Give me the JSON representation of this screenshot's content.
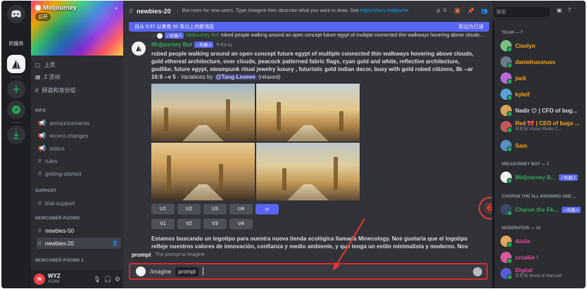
{
  "rail": {
    "label": "的服务",
    "colors": {
      "discord": "#5865f2",
      "green": "#23a55a"
    }
  },
  "server": {
    "name": "Midjourney",
    "badge": "公开",
    "nav": [
      "上页",
      "2 活动",
      "频道和身份组"
    ]
  },
  "categories": {
    "info": "INFO",
    "support": "SUPPORT",
    "newcomer": "NEWCOMER ROOMS",
    "newcomer2": "NEWCOMER ROOMS 2"
  },
  "channels": {
    "info": [
      "announcements",
      "recent-changes",
      "status",
      "rules",
      "getting-started"
    ],
    "support": [
      "trial-support"
    ],
    "newcomer": [
      "newbies-50",
      "newbies-20"
    ]
  },
  "user": {
    "name": "WYZ",
    "tag": "#5264",
    "avatar_text": "W"
  },
  "header": {
    "channel": "newbies-20",
    "topic": "Bot room for new users. Type /imagine then describe what you want to draw. See",
    "topic_link": "https://docs.midjourne",
    "member_count": "5"
  },
  "notice": {
    "text": "自从 9:37 以来有 50 条以上的新消息",
    "action": "标记为已读"
  },
  "reply": {
    "author": "Midjourney Bot",
    "tag": "✓机器人",
    "text": "robed people walking around an open concept future egypt of multiple connected thin walkways hovering above clouds..."
  },
  "message": {
    "author": "Midjourney Bot",
    "tag": "✓机器人",
    "time": "今天9:41",
    "body": "robed people walking around an open concept future egypt of multiple connected thin walkways hovering above clouds, gold ethereal architecture, over clouds, peacock patterned fabric flags, cyan gold and white, reflective architecture, godlike, future egypt, steampunk ritual jewelry luxury , futuristic gold indian decor, busy with gold robed citizens, 8k --ar 16:9 --v 5",
    "meta_prefix": " - Variations by ",
    "mention": "@Tang-Leeeee",
    "meta_suffix": " (relaxed)"
  },
  "buttons": {
    "upscale": [
      "U1",
      "U2",
      "U3",
      "U4"
    ],
    "variations": [
      "V1",
      "V2",
      "V3",
      "V4"
    ]
  },
  "message2": {
    "body": "Estamos buscando un logotipo para nuestra nueva tienda ecológica llamada Minecology. Nos gustaría que el logotipo refleje nuestros valores de innovación, confianza y medio ambiente, y que tenga un estilo minimalista y moderno. Nos"
  },
  "prompt_hint": {
    "name": "prompt",
    "desc": "The prompt to imagine"
  },
  "input": {
    "command": "/imagine",
    "option": "prompt"
  },
  "annotation": {
    "number": "⑥",
    "color": "#e53935"
  },
  "members": {
    "search_placeholder": "搜索",
    "team_label": "TEAM — 7",
    "team": [
      {
        "name": "Cixelyn",
        "sub": "",
        "color": "#faa61a"
      },
      {
        "name": "danielrussruss",
        "sub": "",
        "color": "#faa61a"
      },
      {
        "name": "jack",
        "sub": "",
        "color": "#faa61a"
      },
      {
        "name": "kyleif",
        "sub": "",
        "color": "#faa61a"
      },
      {
        "name": "Nadir 😊 | CFO of bug...",
        "sub": "",
        "color": "#dbdee1"
      },
      {
        "name": "Red 🎀 | CEO of bugs ...",
        "sub": "正在玩 Visual Studio C...",
        "color": "#faa61a"
      },
      {
        "name": "Sam",
        "sub": "",
        "color": "#faa61a"
      }
    ],
    "bot_label": "MIDJOURNEY BOT — 1",
    "bot": {
      "name": "Midjourney B...",
      "tag": "✓机器人",
      "color": "#3ba55c"
    },
    "charon_label": "CHARON THE ALL KNOWING ONE ...",
    "charon": {
      "name": "Charon the FA...",
      "tag": "✓机器人",
      "color": "#3ba55c"
    },
    "moderator_label": "MODERATOR — 13",
    "moderators": [
      {
        "name": "Aixile",
        "sub": "",
        "color": "#eb459e"
      },
      {
        "name": "croakie !",
        "sub": "",
        "color": "#eb459e"
      },
      {
        "name": "Digital",
        "sub": "正在玩 World of Warcraft",
        "color": "#eb459e"
      }
    ]
  }
}
